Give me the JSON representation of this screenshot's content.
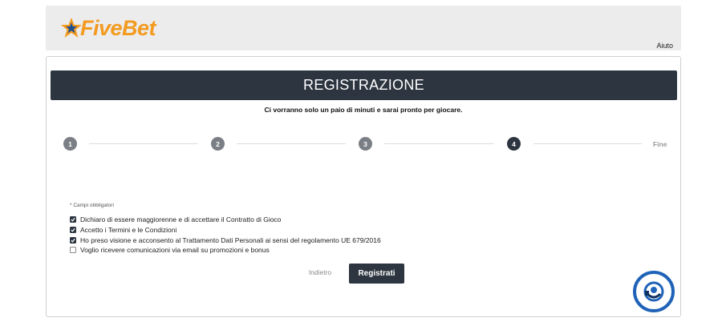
{
  "header": {
    "logo_five": "Five",
    "logo_bet": "Bet",
    "help_label": "Aiuto"
  },
  "form": {
    "title": "REGISTRAZIONE",
    "subtitle": "Ci vorranno solo un paio di minuti e sarai pronto per giocare.",
    "steps": [
      "1",
      "2",
      "3",
      "4"
    ],
    "active_step": 4,
    "end_label": "Fine",
    "required_note": "* Campi obbligatori",
    "checkboxes": [
      {
        "label": "Dichiaro di essere maggiorenne e di accettare il Contratto di Gioco",
        "checked": true
      },
      {
        "label": "Accetto i Termini e le Condizioni",
        "checked": true
      },
      {
        "label": "Ho preso visione e acconsento al Trattamento Dati Personali ai sensi del regolamento UE 679/2016",
        "checked": true
      },
      {
        "label": "Voglio ricevere comunicazioni via email su promozioni e bonus",
        "checked": false
      }
    ],
    "back_label": "Indietro",
    "submit_label": "Registrati"
  },
  "colors": {
    "brand_orange": "#f39a1f",
    "dark": "#2c3540",
    "step_inactive": "#7a7f86",
    "support_blue": "#1f63b8"
  },
  "icons": {
    "logo": "star-logo-icon",
    "support": "support-chat-icon"
  }
}
